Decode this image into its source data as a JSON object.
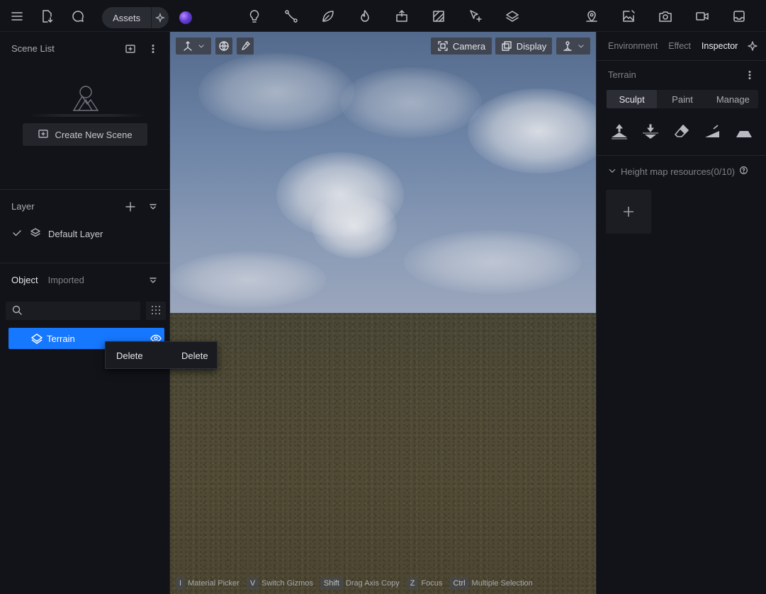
{
  "topbar": {
    "assets_label": "Assets",
    "left_icons": [
      "menu-icon",
      "file-download-icon",
      "chat-bubble-icon"
    ],
    "tool_icons": [
      "lightbulb-icon",
      "path-nodes-icon",
      "leaf-icon",
      "flame-icon",
      "import-box-icon",
      "hatch-area-icon",
      "select-plus-icon",
      "layers-stack-icon"
    ],
    "right_icons": [
      "map-pin-icon",
      "image-edit-icon",
      "camera-icon",
      "video-icon",
      "inbox-icon"
    ]
  },
  "scene_list": {
    "title": "Scene List",
    "create_label": "Create New Scene"
  },
  "layer": {
    "title": "Layer",
    "items": [
      {
        "label": "Default Layer",
        "checked": true
      }
    ]
  },
  "objects": {
    "tab_object": "Object",
    "tab_imported": "Imported",
    "search_placeholder": "",
    "items": [
      {
        "label": "Terrain",
        "selected": true,
        "visible": true
      }
    ]
  },
  "context_menu": {
    "item_label": "Delete",
    "item_shortcut": "Delete"
  },
  "viewport": {
    "camera_label": "Camera",
    "display_label": "Display",
    "hints": [
      {
        "key": "I",
        "text": "Material Picker"
      },
      {
        "key": "V",
        "text": "Switch Gizmos"
      },
      {
        "key": "Shift",
        "text": "Drag Axis Copy"
      },
      {
        "key": "Z",
        "text": "Focus"
      },
      {
        "key": "Ctrl",
        "text": "Multiple Selection"
      }
    ]
  },
  "inspector": {
    "tabs": [
      "Environment",
      "Effect",
      "Inspector"
    ],
    "active_tab": "Inspector",
    "section_title": "Terrain",
    "segments": [
      "Sculpt",
      "Paint",
      "Manage"
    ],
    "active_segment": "Sculpt",
    "tools": [
      "raise-terrain-icon",
      "lower-terrain-icon",
      "eraser-icon",
      "slope-icon",
      "flatten-icon"
    ],
    "height_map_label": "Height map resources(0/10)"
  },
  "colors": {
    "accent": "#1677ff",
    "background": "#121318",
    "panel": "#1d1e24"
  }
}
